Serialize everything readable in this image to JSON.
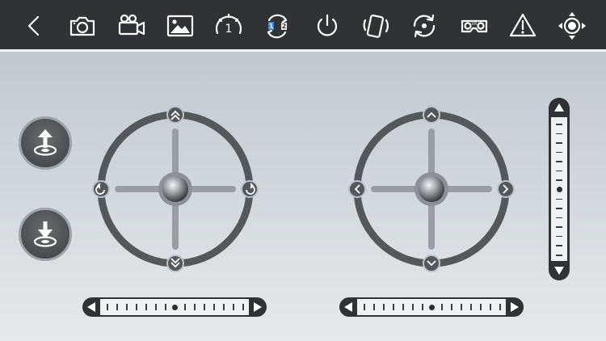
{
  "toolbar": {
    "items": [
      {
        "id": "back",
        "icon": "chevron-left-icon"
      },
      {
        "id": "photo",
        "icon": "camera-icon"
      },
      {
        "id": "video",
        "icon": "video-camera-icon"
      },
      {
        "id": "gallery",
        "icon": "image-icon"
      },
      {
        "id": "speed",
        "icon": "speed-gauge-icon",
        "label": "1"
      },
      {
        "id": "mode",
        "icon": "mode-switch-icon",
        "label_a": "1",
        "label_b": "2"
      },
      {
        "id": "power",
        "icon": "power-icon"
      },
      {
        "id": "gravity",
        "icon": "phone-tilt-icon"
      },
      {
        "id": "rotate",
        "icon": "rotate-icon"
      },
      {
        "id": "vr",
        "icon": "vr-headset-icon",
        "label": "VR"
      },
      {
        "id": "emergency",
        "icon": "warning-icon"
      },
      {
        "id": "headless",
        "icon": "drone-target-icon"
      }
    ]
  },
  "left_controls": {
    "takeoff": {
      "icon": "takeoff-icon"
    },
    "landing": {
      "icon": "landing-icon"
    }
  },
  "joysticks": [
    {
      "id": "left",
      "arrows": {
        "up": "double-chevron-up-icon",
        "down": "double-chevron-down-icon",
        "left": "rotate-ccw-icon",
        "right": "rotate-cw-icon"
      }
    },
    {
      "id": "right",
      "arrows": {
        "up": "chevron-up-icon",
        "down": "chevron-down-icon",
        "left": "chevron-left-icon",
        "right": "chevron-right-icon"
      }
    }
  ],
  "trims": {
    "left_horizontal": {
      "position": 0.5,
      "ticks": 15
    },
    "right_horizontal": {
      "position": 0.5,
      "ticks": 15
    },
    "vertical": {
      "position": 0.5,
      "ticks": 15
    }
  },
  "colors": {
    "toolbar_bg": "#303235",
    "icon": "#ffffff",
    "mode_accent": "#3b8ad9",
    "ring": "#55585b",
    "cross": "#9a9ea2"
  }
}
